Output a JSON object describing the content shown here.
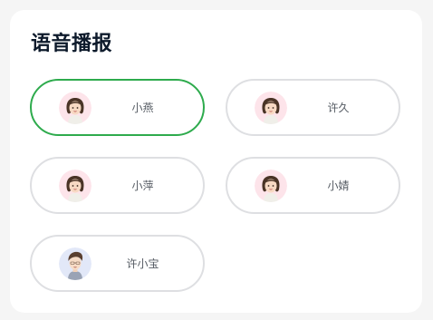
{
  "title": "语音播报",
  "voices": [
    {
      "name": "小燕",
      "avatar": "female-avatar-icon",
      "selected": true
    },
    {
      "name": "许久",
      "avatar": "female-avatar-icon",
      "selected": false
    },
    {
      "name": "小萍",
      "avatar": "female-avatar-icon",
      "selected": false
    },
    {
      "name": "小婧",
      "avatar": "female-avatar-icon",
      "selected": false
    },
    {
      "name": "许小宝",
      "avatar": "male-avatar-icon",
      "selected": false
    }
  ],
  "colors": {
    "selected_border": "#2eab4d",
    "default_border": "#dedfe2",
    "title": "#0d1a2b",
    "female_avatar_bg": "#fde4ea",
    "male_avatar_bg": "#e2e8f8"
  }
}
